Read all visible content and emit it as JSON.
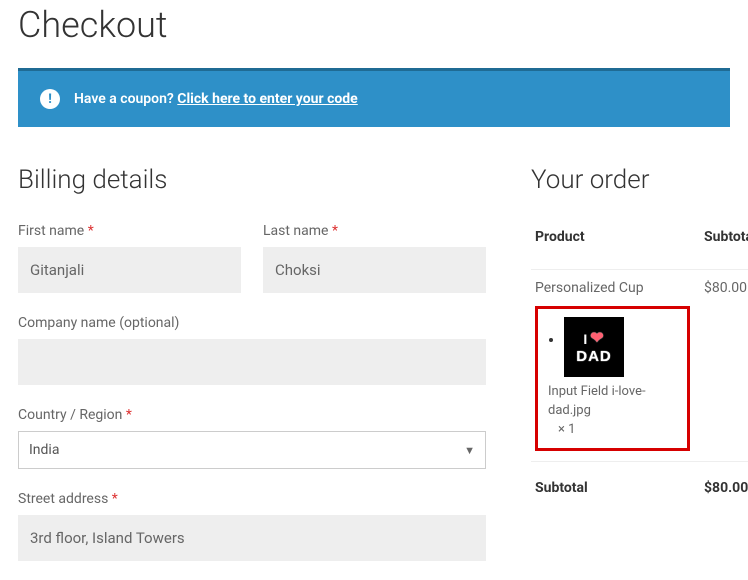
{
  "page": {
    "title": "Checkout"
  },
  "coupon": {
    "prompt": "Have a coupon?",
    "link": "Click here to enter your code"
  },
  "billing": {
    "heading": "Billing details",
    "first_name": {
      "label": "First name",
      "value": "Gitanjali"
    },
    "last_name": {
      "label": "Last name",
      "value": "Choksi"
    },
    "company": {
      "label": "Company name (optional)",
      "value": ""
    },
    "country": {
      "label": "Country / Region",
      "value": "India"
    },
    "street": {
      "label": "Street address",
      "value": "3rd floor, Island Towers"
    }
  },
  "order": {
    "heading": "Your order",
    "col_product": "Product",
    "col_subtotal": "Subtotal",
    "item": {
      "name": "Personalized Cup",
      "price": "$80.00",
      "meta_label": "Input Field",
      "meta_value": "i-love-dad.jpg",
      "qty": "× 1",
      "thumb_top": "I",
      "thumb_bottom": "DAD"
    },
    "subtotal_label": "Subtotal",
    "subtotal_value": "$80.00"
  },
  "glyphs": {
    "required": "*"
  }
}
